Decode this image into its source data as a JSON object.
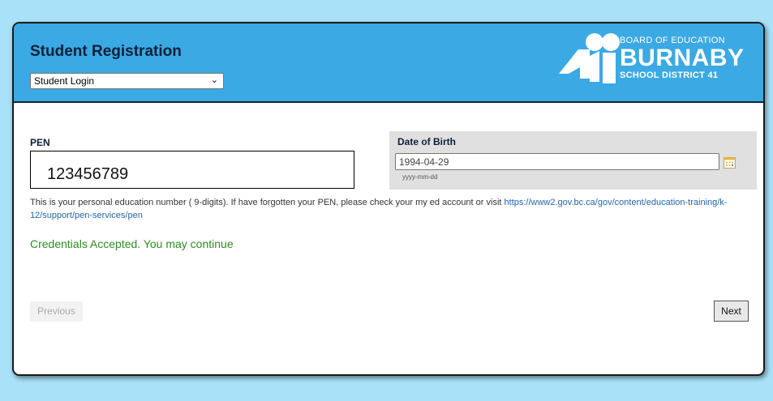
{
  "header": {
    "title": "Student Registration",
    "role_select": {
      "value": "Student Login"
    },
    "logo": {
      "line1": "BOARD OF EDUCATION",
      "line2": "BURNABY",
      "line3": "SCHOOL DISTRICT 41"
    }
  },
  "form": {
    "pen": {
      "label": "PEN",
      "value": "123456789"
    },
    "dob": {
      "label": "Date of Birth",
      "value": "1994-04-29",
      "hint": "yyyy-mm-dd"
    },
    "help_text": "This is your personal education number ( 9-digits). If have forgotten your PEN, please check your my ed account or visit",
    "help_link": "https://www2.gov.bc.ca/gov/content/education-training/k-12/support/pen-services/pen",
    "status_message": "Credentials Accepted. You may continue"
  },
  "nav": {
    "previous_label": "Previous",
    "next_label": "Next"
  },
  "colors": {
    "page_bg": "#a9e1f9",
    "header_bg": "#3ba9e3",
    "success": "#2e8b22",
    "link": "#2266aa"
  }
}
